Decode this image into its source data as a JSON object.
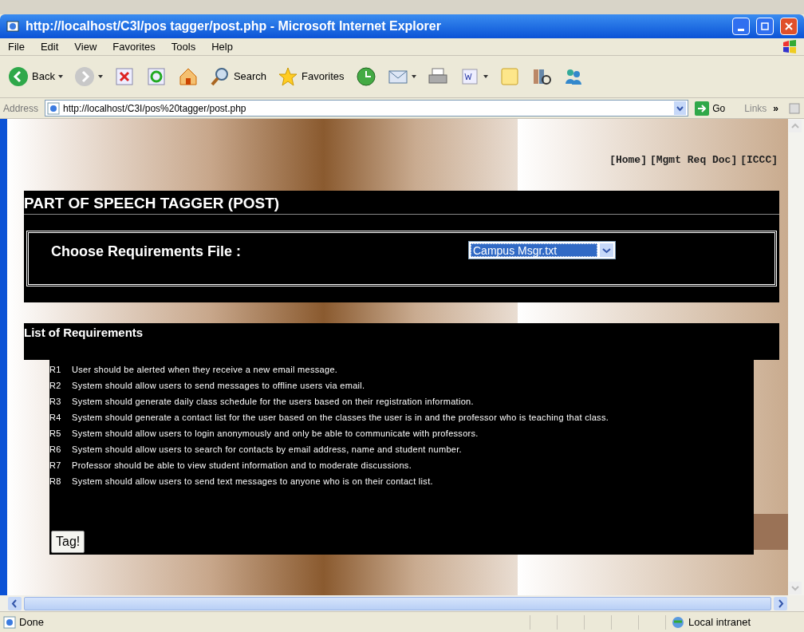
{
  "window": {
    "title": "http://localhost/C3I/pos tagger/post.php - Microsoft Internet Explorer"
  },
  "menu": [
    "File",
    "Edit",
    "View",
    "Favorites",
    "Tools",
    "Help"
  ],
  "toolbar": [
    {
      "kind": "back",
      "label": "Back"
    },
    {
      "kind": "forward"
    },
    {
      "kind": "stop"
    },
    {
      "kind": "refresh"
    },
    {
      "kind": "home"
    },
    {
      "kind": "search",
      "label": "Search"
    },
    {
      "kind": "favorites",
      "label": "Favorites"
    },
    {
      "kind": "history"
    },
    {
      "kind": "mail"
    },
    {
      "kind": "print"
    },
    {
      "kind": "word"
    },
    {
      "kind": "note"
    },
    {
      "kind": "research"
    },
    {
      "kind": "messenger"
    }
  ],
  "address": {
    "label": "Address",
    "value": "http://localhost/C3I/pos%20tagger/post.php",
    "go": "Go",
    "links": "Links",
    "chevron": "»"
  },
  "page": {
    "nav": [
      "[Home]",
      "[Mgmt Req Doc]",
      "[ICCC]"
    ],
    "heading": "PART OF SPEECH TAGGER (POST)",
    "file_label": "Choose Requirements File :",
    "file_select": {
      "value": "Campus Msgr.txt"
    },
    "list_heading": "List of Requirements",
    "requirements": [
      {
        "id": "R1",
        "text": "User should be alerted when they receive a new email message."
      },
      {
        "id": "R2",
        "text": "System should allow users to send messages to offline users via email."
      },
      {
        "id": "R3",
        "text": "System should generate daily class schedule for the users based on their registration information."
      },
      {
        "id": "R4",
        "text": "System should generate a contact list for the user based on the classes the user is in and the professor who is teaching that class."
      },
      {
        "id": "R5",
        "text": "System should allow users to login anonymously and only be able to communicate with professors."
      },
      {
        "id": "R6",
        "text": "System should allow users to search for contacts by email address, name and student number."
      },
      {
        "id": "R7",
        "text": "Professor should be able to view student information and to moderate discussions."
      },
      {
        "id": "R8",
        "text": "System should allow users to send text messages to anyone who is on their contact list."
      }
    ],
    "button": "Tag!"
  },
  "status_bar": {
    "text": "Done",
    "zone": "Local intranet"
  }
}
